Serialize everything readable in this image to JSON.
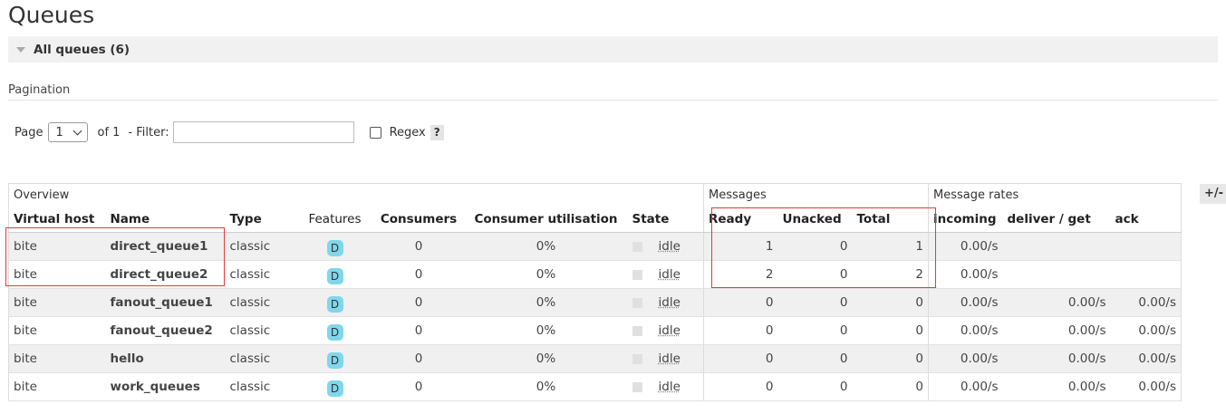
{
  "page": {
    "title": "Queues",
    "section_label": "All queues (6)"
  },
  "pagination": {
    "label": "Pagination",
    "page_label": "Page",
    "page_value": "1",
    "of_label": "of 1",
    "filter_label": "- Filter:",
    "filter_value": "",
    "regex_label": "Regex",
    "help_label": "?"
  },
  "table": {
    "groups": {
      "overview": "Overview",
      "messages": "Messages",
      "message_rates": "Message rates"
    },
    "columns": {
      "virtual_host": "Virtual host",
      "name": "Name",
      "type": "Type",
      "features": "Features",
      "consumers": "Consumers",
      "consumer_utilisation": "Consumer utilisation",
      "state": "State",
      "ready": "Ready",
      "unacked": "Unacked",
      "total": "Total",
      "incoming": "incoming",
      "deliver_get": "deliver / get",
      "ack": "ack"
    },
    "column_toggle": "+/-",
    "rows": [
      {
        "vhost": "bite",
        "name": "direct_queue1",
        "type": "classic",
        "feature": "D",
        "consumers": "0",
        "utilisation": "0%",
        "state": "idle",
        "ready": "1",
        "unacked": "0",
        "total": "1",
        "incoming": "0.00/s",
        "deliver": "",
        "ack": ""
      },
      {
        "vhost": "bite",
        "name": "direct_queue2",
        "type": "classic",
        "feature": "D",
        "consumers": "0",
        "utilisation": "0%",
        "state": "idle",
        "ready": "2",
        "unacked": "0",
        "total": "2",
        "incoming": "0.00/s",
        "deliver": "",
        "ack": ""
      },
      {
        "vhost": "bite",
        "name": "fanout_queue1",
        "type": "classic",
        "feature": "D",
        "consumers": "0",
        "utilisation": "0%",
        "state": "idle",
        "ready": "0",
        "unacked": "0",
        "total": "0",
        "incoming": "0.00/s",
        "deliver": "0.00/s",
        "ack": "0.00/s"
      },
      {
        "vhost": "bite",
        "name": "fanout_queue2",
        "type": "classic",
        "feature": "D",
        "consumers": "0",
        "utilisation": "0%",
        "state": "idle",
        "ready": "0",
        "unacked": "0",
        "total": "0",
        "incoming": "0.00/s",
        "deliver": "0.00/s",
        "ack": "0.00/s"
      },
      {
        "vhost": "bite",
        "name": "hello",
        "type": "classic",
        "feature": "D",
        "consumers": "0",
        "utilisation": "0%",
        "state": "idle",
        "ready": "0",
        "unacked": "0",
        "total": "0",
        "incoming": "0.00/s",
        "deliver": "0.00/s",
        "ack": "0.00/s"
      },
      {
        "vhost": "bite",
        "name": "work_queues",
        "type": "classic",
        "feature": "D",
        "consumers": "0",
        "utilisation": "0%",
        "state": "idle",
        "ready": "0",
        "unacked": "0",
        "total": "0",
        "incoming": "0.00/s",
        "deliver": "0.00/s",
        "ack": "0.00/s"
      }
    ]
  },
  "colors": {
    "feature_badge": "#7fd7ec",
    "highlight": "#e03a3a",
    "row_alt": "#f0f0f0"
  }
}
